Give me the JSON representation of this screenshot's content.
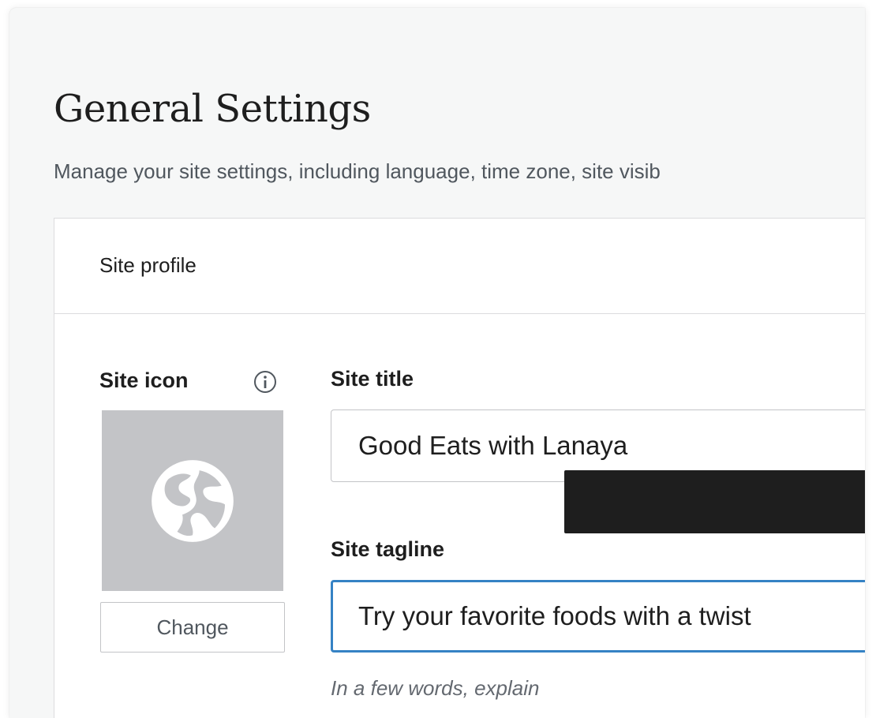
{
  "header": {
    "title": "General Settings",
    "subtitle": "Manage your site settings, including language, time zone, site visib"
  },
  "site_profile": {
    "section_label": "Site profile",
    "site_icon": {
      "label": "Site icon",
      "info_icon": "info-icon",
      "placeholder_icon": "globe-icon",
      "change_button_label": "Change"
    },
    "site_title": {
      "label": "Site title",
      "value": "Good Eats with Lanaya"
    },
    "site_tagline": {
      "label": "Site tagline",
      "value": "Try your favorite foods with a twist",
      "help_text": "In a few words, explain"
    }
  },
  "colors": {
    "focus_border": "#3582c4",
    "icon_placeholder_bg": "#c3c4c7",
    "page_bg": "#f6f7f7"
  }
}
